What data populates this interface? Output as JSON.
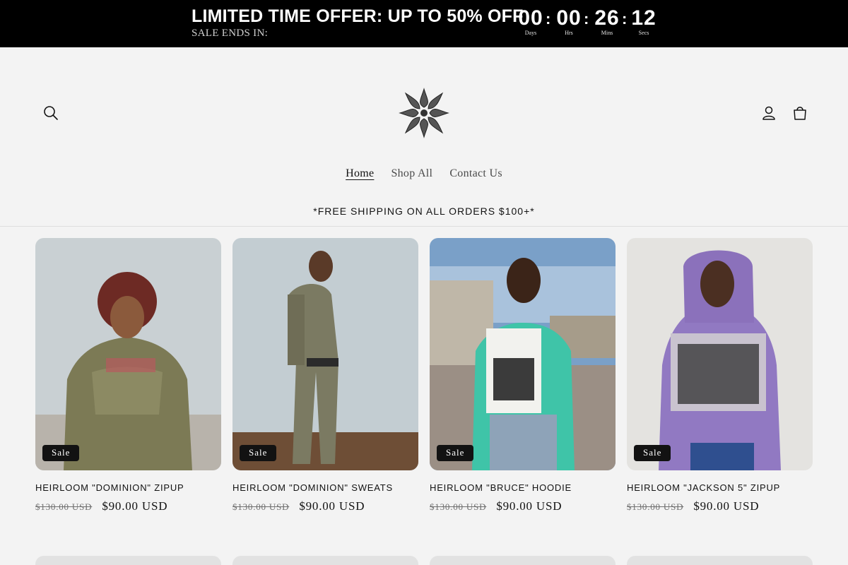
{
  "promo": {
    "title": "LIMITED TIME OFFER: UP TO 50% OFF",
    "subtitle": "SALE ENDS IN:",
    "countdown": {
      "days": "00",
      "days_label": "Days",
      "hours": "00",
      "hours_label": "Hrs",
      "mins": "26",
      "mins_label": "Mins",
      "secs": "12",
      "secs_label": "Secs",
      "separator": ":"
    }
  },
  "header": {
    "icons": {
      "search": "search-icon",
      "account": "account-icon",
      "cart": "cart-icon",
      "logo": "brand-logo"
    },
    "nav": [
      {
        "label": "Home",
        "active": true
      },
      {
        "label": "Shop All",
        "active": false
      },
      {
        "label": "Contact Us",
        "active": false
      }
    ],
    "shipping": "*FREE SHIPPING ON ALL ORDERS $100+*"
  },
  "products": [
    {
      "badge": "Sale",
      "title": "HEIRLOOM \"DOMINION\" ZIPUP",
      "old_price": "$130.00 USD",
      "price": "$90.00 USD"
    },
    {
      "badge": "Sale",
      "title": "HEIRLOOM \"DOMINION\" SWEATS",
      "old_price": "$130.00 USD",
      "price": "$90.00 USD"
    },
    {
      "badge": "Sale",
      "title": "HEIRLOOM \"BRUCE\" HOODIE",
      "old_price": "$130.00 USD",
      "price": "$90.00 USD"
    },
    {
      "badge": "Sale",
      "title": "HEIRLOOM \"JACKSON 5\" ZIPUP",
      "old_price": "$130.00 USD",
      "price": "$90.00 USD"
    }
  ],
  "colors": {
    "bar": "#000000",
    "background": "#f3f3f3",
    "badge": "#121212"
  }
}
